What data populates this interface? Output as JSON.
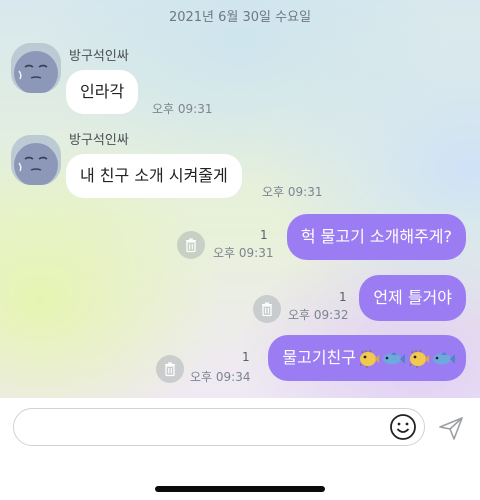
{
  "header": {
    "date": "2021년 6월 30일 수요일"
  },
  "messages_in": [
    {
      "sender": "방구석인싸",
      "text": "인라각",
      "time": "오후 09:31"
    },
    {
      "sender": "방구석인싸",
      "text": "내 친구 소개 시켜줄게",
      "time": "오후 09:31"
    }
  ],
  "messages_out": [
    {
      "text": "헉 물고기 소개해주게?",
      "time": "오후 09:31",
      "unread": "1"
    },
    {
      "text": "언제 틀거야",
      "time": "오후 09:32",
      "unread": "1"
    },
    {
      "text": "물고기친구",
      "time": "오후 09:34",
      "unread": "1",
      "emoji": [
        "blowfish",
        "fish",
        "blowfish",
        "fish"
      ]
    }
  ],
  "composer": {
    "value": ""
  },
  "colors": {
    "outgoing_bubble": "#9c7cf2",
    "incoming_bubble": "#ffffff"
  },
  "icons": [
    "trash-icon",
    "emoji-icon",
    "send-icon",
    "avatar-icon",
    "blowfish-icon",
    "fish-icon"
  ]
}
